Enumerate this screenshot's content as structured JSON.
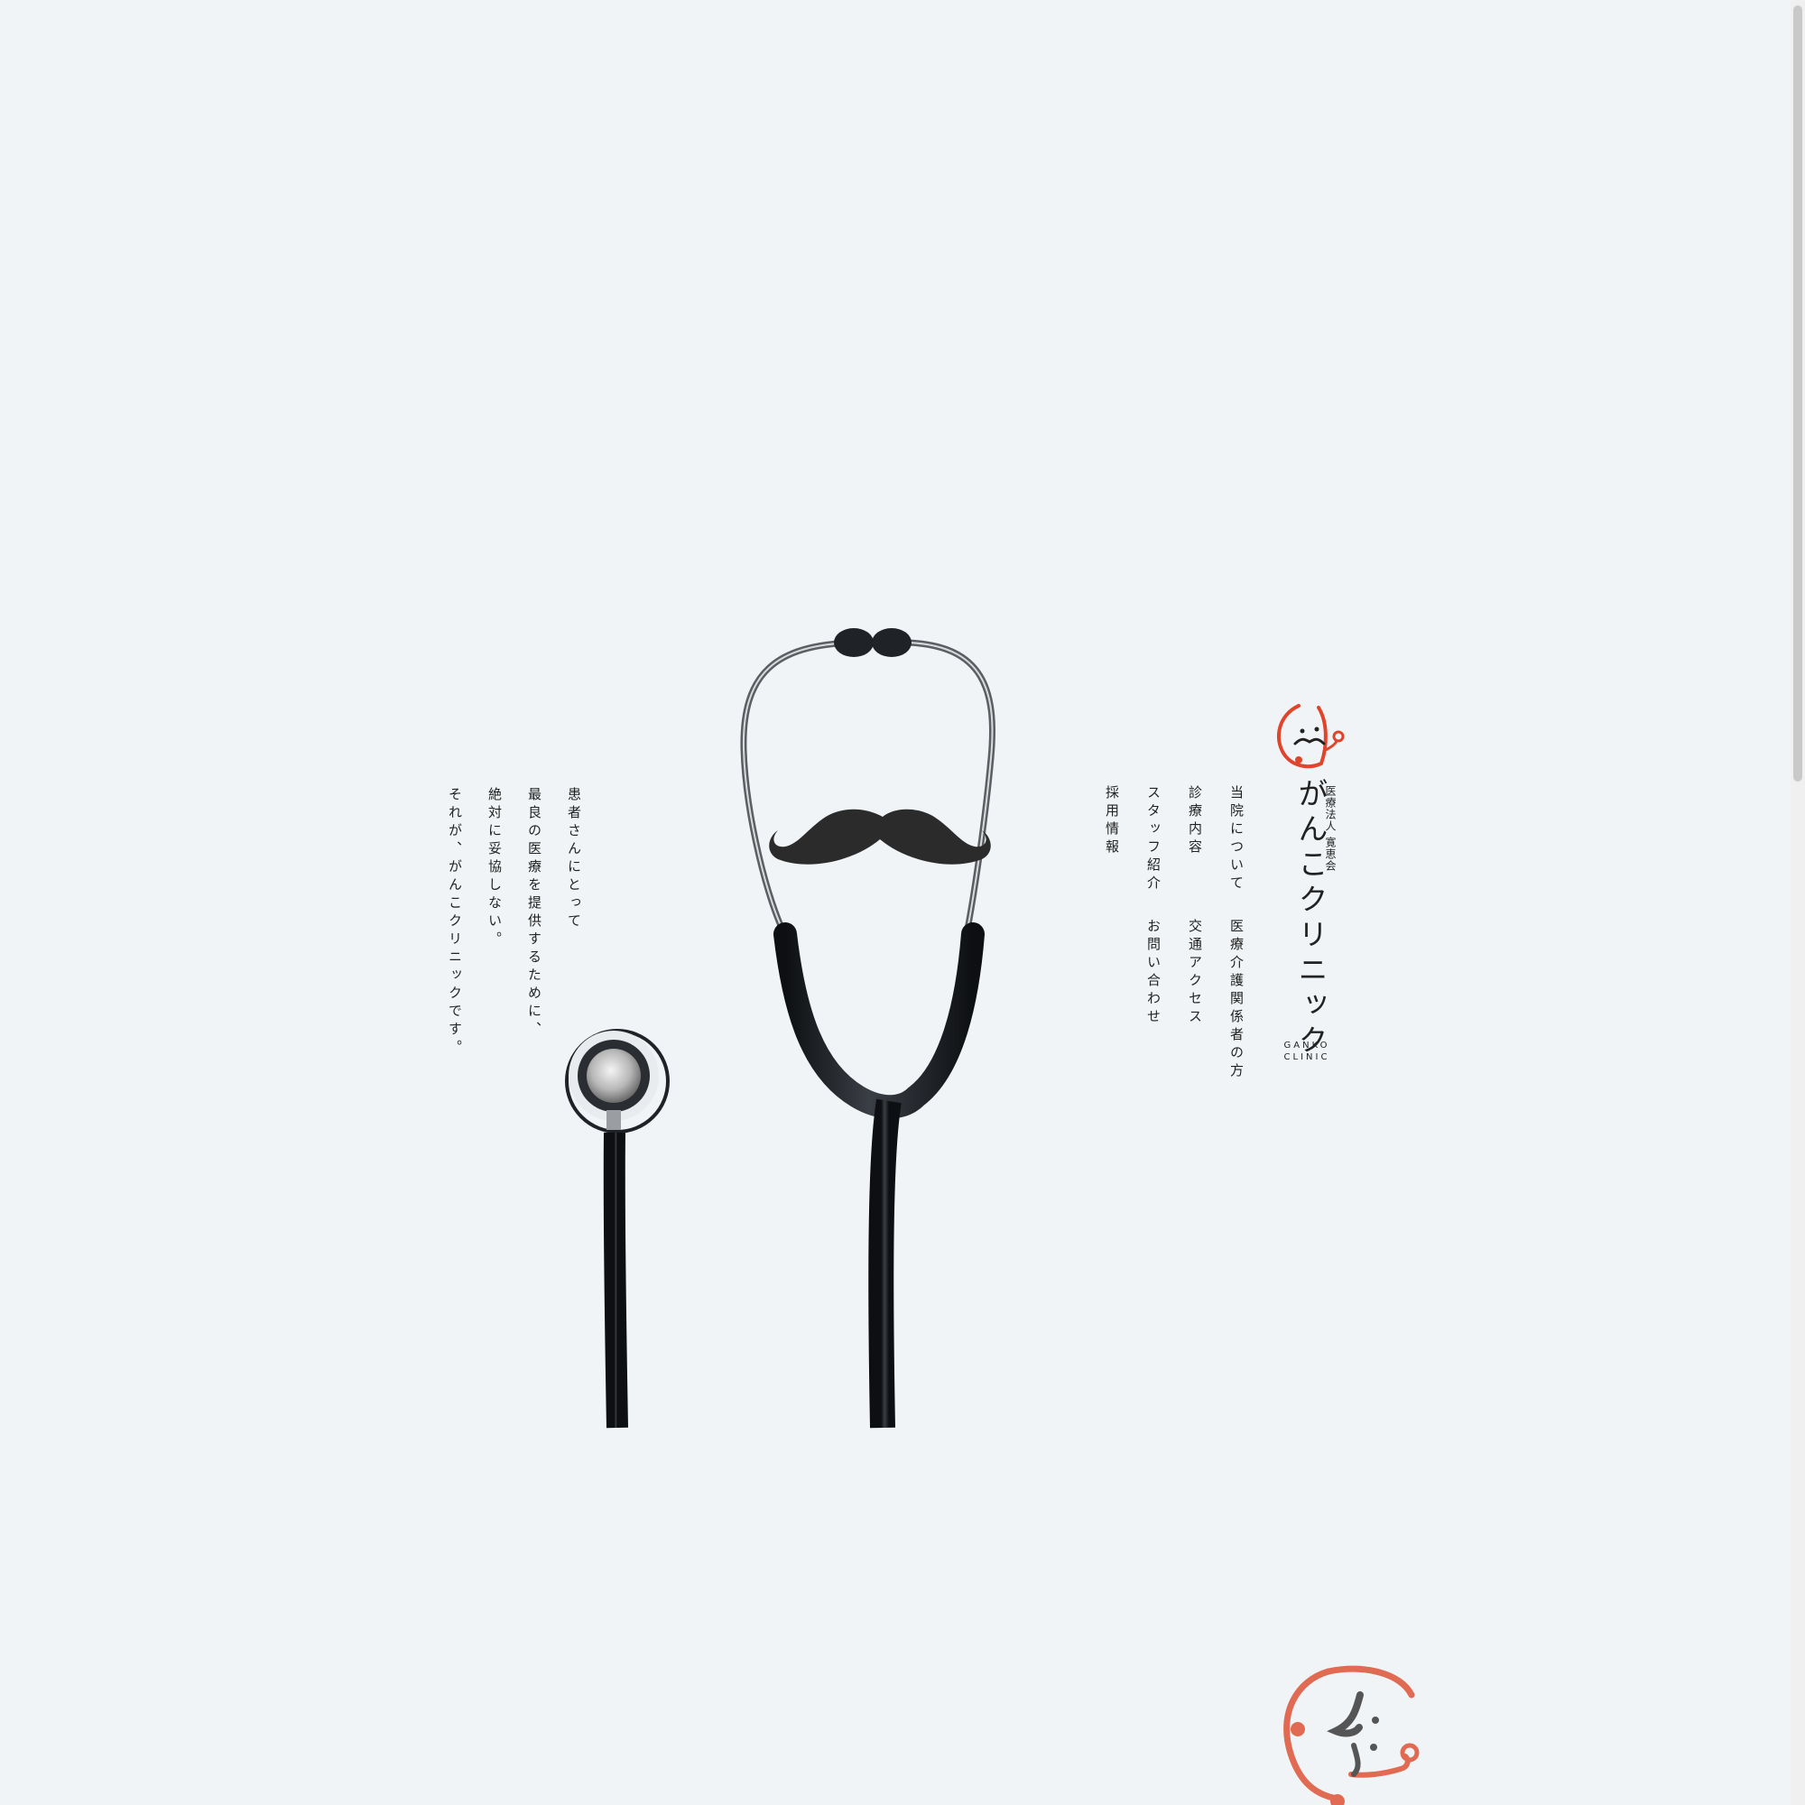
{
  "tagline": {
    "lines": [
      "患者さんにとって",
      "最良の医療を提供するために、",
      "絶対に妥協しない。",
      "それが、がんこクリニックです。"
    ]
  },
  "logo": {
    "corporation": "医療法人 寛恵会",
    "name": "がんこクリニック",
    "english_line1": "GANKO",
    "english_line2": "CLINIC"
  },
  "nav": {
    "items": [
      "当院について",
      "診療内容",
      "スタッフ紹介",
      "採用情報",
      "医療介護関係者の方",
      "交通アクセス",
      "お問い合わせ"
    ]
  },
  "colors": {
    "background": "#f0f4f6",
    "brand_accent": "#e0452b",
    "text": "#222222",
    "stethoscope": "#1f2328"
  }
}
